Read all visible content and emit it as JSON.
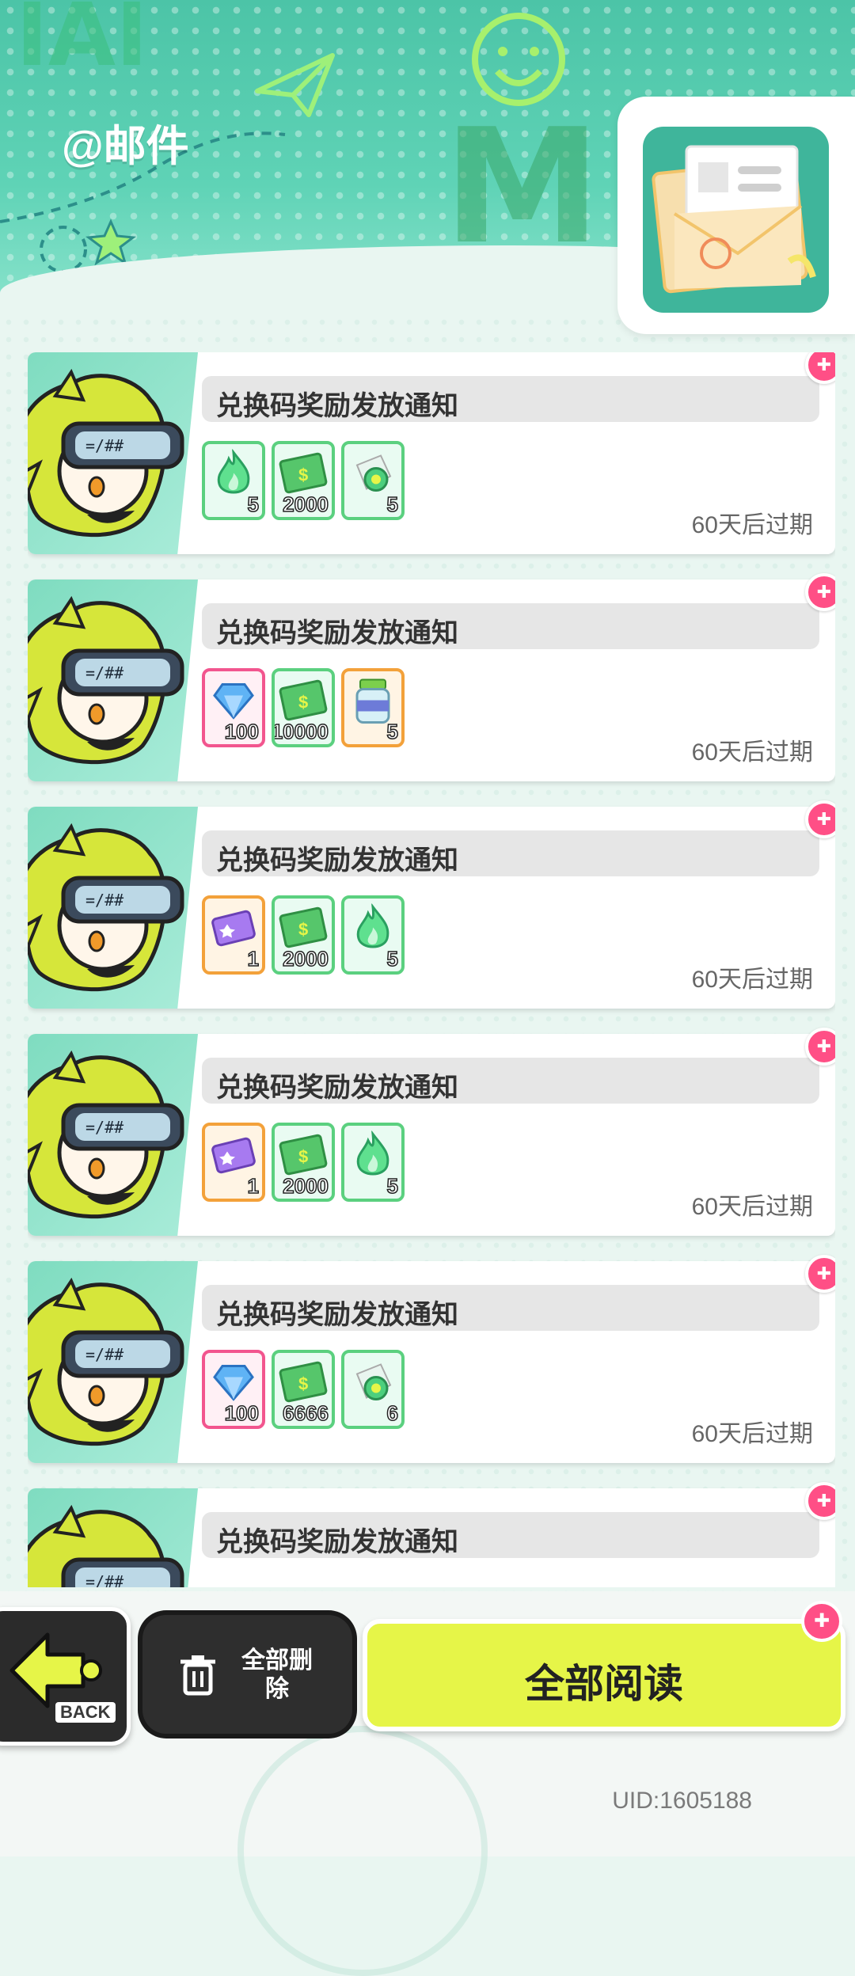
{
  "header": {
    "title": "@邮件"
  },
  "colors": {
    "accent": "#e6f548",
    "header": "#4cc4a7",
    "gift": "#ff4f86"
  },
  "mails": [
    {
      "title": "兑换码奖励发放通知",
      "expiry": "60天后过期",
      "items": [
        {
          "icon": "green-flame-icon",
          "qty": "5",
          "frame": "green"
        },
        {
          "icon": "cash-icon",
          "qty": "2000",
          "frame": "green"
        },
        {
          "icon": "green-coin-icon",
          "qty": "5",
          "frame": "green"
        }
      ]
    },
    {
      "title": "兑换码奖励发放通知",
      "expiry": "60天后过期",
      "items": [
        {
          "icon": "blue-diamond-icon",
          "qty": "100",
          "frame": "pink"
        },
        {
          "icon": "cash-icon",
          "qty": "10000",
          "frame": "green"
        },
        {
          "icon": "jar-icon",
          "qty": "5",
          "frame": "orange"
        }
      ]
    },
    {
      "title": "兑换码奖励发放通知",
      "expiry": "60天后过期",
      "items": [
        {
          "icon": "purple-ticket-icon",
          "qty": "1",
          "frame": "orange"
        },
        {
          "icon": "cash-icon",
          "qty": "2000",
          "frame": "green"
        },
        {
          "icon": "green-flame-icon",
          "qty": "5",
          "frame": "green"
        }
      ]
    },
    {
      "title": "兑换码奖励发放通知",
      "expiry": "60天后过期",
      "items": [
        {
          "icon": "purple-ticket-icon",
          "qty": "1",
          "frame": "orange"
        },
        {
          "icon": "cash-icon",
          "qty": "2000",
          "frame": "green"
        },
        {
          "icon": "green-flame-icon",
          "qty": "5",
          "frame": "green"
        }
      ]
    },
    {
      "title": "兑换码奖励发放通知",
      "expiry": "60天后过期",
      "items": [
        {
          "icon": "blue-diamond-icon",
          "qty": "100",
          "frame": "pink"
        },
        {
          "icon": "cash-icon",
          "qty": "6666",
          "frame": "green"
        },
        {
          "icon": "green-coin-icon",
          "qty": "6",
          "frame": "green"
        }
      ]
    },
    {
      "title": "兑换码奖励发放通知",
      "expiry": "",
      "items": []
    }
  ],
  "footer": {
    "back_label": "BACK",
    "delete_all_label": "全部删除",
    "read_all_label": "全部阅读",
    "uid": "UID:1605188"
  }
}
